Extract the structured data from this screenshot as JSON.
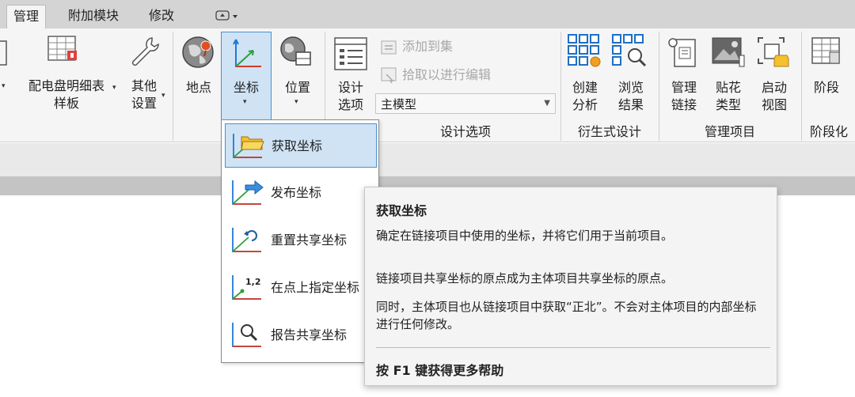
{
  "tabs": [
    "管理",
    "附加模块",
    "修改"
  ],
  "ribbon": {
    "buttons": {
      "panel_schedule_line1": "配电盘明细表",
      "panel_schedule_line2": "样板",
      "other_line1": "其他",
      "other_line2": "设置",
      "location": "地点",
      "coordinates": "坐标",
      "position": "位置",
      "design_line1": "设计",
      "design_line2": "选项",
      "create_line1": "创建",
      "create_line2": "分析",
      "browse_line1": "浏览",
      "browse_line2": "结果",
      "manage_line1": "管理",
      "manage_line2": "链接",
      "decal_line1": "贴花",
      "decal_line2": "类型",
      "startup_line1": "启动",
      "startup_line2": "视图",
      "phase": "阶段"
    },
    "design_options": {
      "add_to_set": "添加到集",
      "pick_to_edit": "拾取以进行编辑",
      "combo_value": "主模型"
    },
    "panel_titles": {
      "design_options": "设计选项",
      "generative": "衍生式设计",
      "manage_project": "管理项目",
      "phasing": "阶段化"
    }
  },
  "dropdown": {
    "items": [
      "获取坐标",
      "发布坐标",
      "重置共享坐标",
      "在点上指定坐标",
      "报告共享坐标"
    ],
    "specify_icon_text": "1,2"
  },
  "tooltip": {
    "title": "获取坐标",
    "p1": "确定在链接项目中使用的坐标，并将它们用于当前项目。",
    "p2": "链接项目共享坐标的原点成为主体项目共享坐标的原点。",
    "p3": "同时，主体项目也从链接项目中获取“正北”。不会对主体项目的内部坐标进行任何修改。",
    "help": "按 F1 键获得更多帮助"
  },
  "colors": {
    "accent_blue": "#4d8fd0",
    "green": "#2e9e3a",
    "red": "#d43a2a",
    "selected_bg": "#cfe3f5"
  },
  "icons": [
    "panel-schedule-icon",
    "wrench-icon",
    "globe-pin-icon",
    "coordinates-axis-icon",
    "position-globe-icon",
    "design-options-icon",
    "create-analysis-icon",
    "browse-results-icon",
    "manage-links-icon",
    "decal-types-icon",
    "starting-view-icon",
    "phases-icon",
    "folder-coords-icon",
    "publish-arrow-icon",
    "reset-arrow-icon",
    "point-coords-icon",
    "magnifier-coords-icon"
  ]
}
